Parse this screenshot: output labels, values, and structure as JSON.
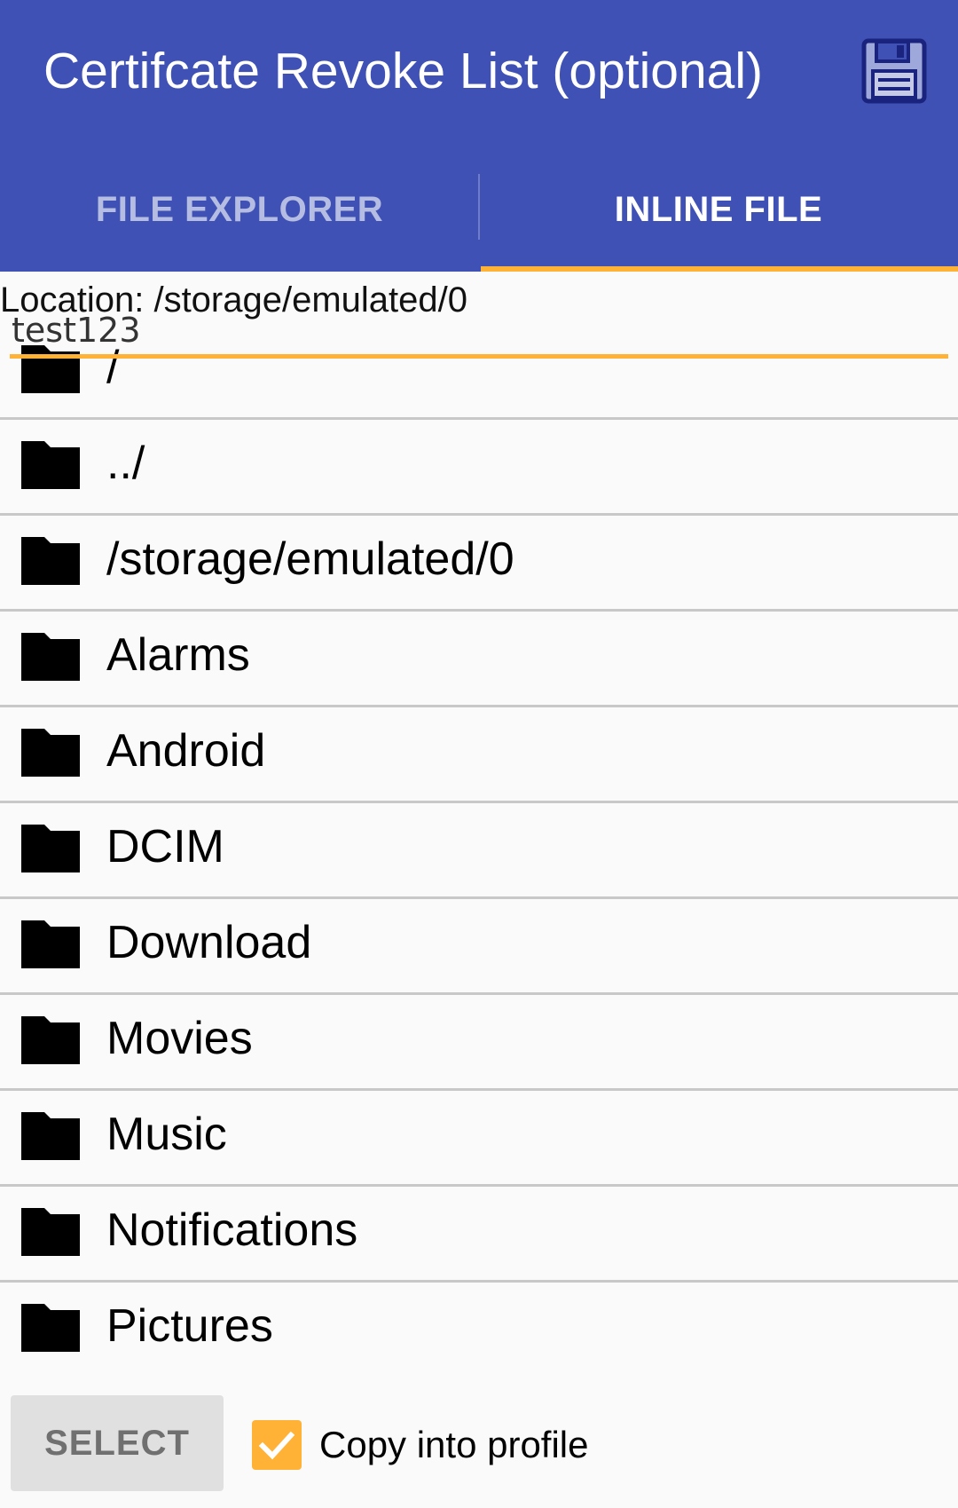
{
  "app_bar": {
    "title": "Certifcate Revoke List (optional)",
    "save_icon": "save-icon",
    "color": "#3f51b5"
  },
  "tabs": [
    {
      "label": "FILE EXPLORER",
      "selected": false
    },
    {
      "label": "INLINE FILE",
      "selected": true
    }
  ],
  "accent_color": "#ffb236",
  "location": "Location: /storage/emulated/0",
  "inline_input": {
    "value": "test123"
  },
  "files": [
    {
      "name": "/",
      "icon": "folder-icon"
    },
    {
      "name": "../",
      "icon": "folder-icon"
    },
    {
      "name": "/storage/emulated/0",
      "icon": "folder-icon"
    },
    {
      "name": "Alarms",
      "icon": "folder-icon"
    },
    {
      "name": "Android",
      "icon": "folder-icon"
    },
    {
      "name": "DCIM",
      "icon": "folder-icon"
    },
    {
      "name": "Download",
      "icon": "folder-icon"
    },
    {
      "name": "Movies",
      "icon": "folder-icon"
    },
    {
      "name": "Music",
      "icon": "folder-icon"
    },
    {
      "name": "Notifications",
      "icon": "folder-icon"
    },
    {
      "name": "Pictures",
      "icon": "folder-icon"
    }
  ],
  "bottom": {
    "select_label": "SELECT",
    "copy_checked": true,
    "copy_label": "Copy into profile"
  }
}
